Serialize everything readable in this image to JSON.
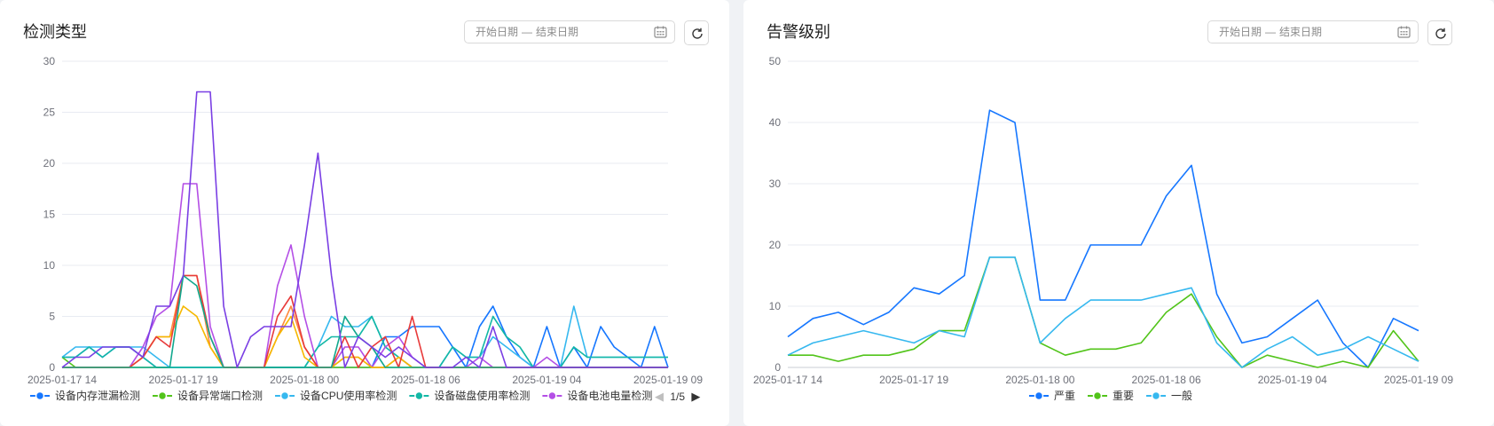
{
  "panels": {
    "left": {
      "title": "检测类型",
      "date_start_placeholder": "开始日期",
      "date_separator": "—",
      "date_end_placeholder": "结束日期",
      "legend_page": "1/5"
    },
    "right": {
      "title": "告警级别",
      "date_start_placeholder": "开始日期",
      "date_separator": "—",
      "date_end_placeholder": "结束日期"
    }
  },
  "icons": {
    "calendar": "calendar-icon",
    "refresh": "refresh-icon",
    "prev": "triangle-left-icon",
    "next": "triangle-right-icon"
  },
  "chart_data": [
    {
      "type": "line",
      "x_tick_labels": [
        "2025-01-17 14",
        "2025-01-17 19",
        "2025-01-18 00",
        "2025-01-18 06",
        "2025-01-19 04",
        "2025-01-19 09"
      ],
      "ylim": [
        0,
        30
      ],
      "yticks": [
        0,
        5,
        10,
        15,
        20,
        25,
        30
      ],
      "grid": true,
      "legend_position": "bottom",
      "series": [
        {
          "name": "设备内存泄漏检测",
          "color": "#1677ff",
          "values": [
            1,
            1,
            2,
            1,
            2,
            2,
            1,
            0,
            0,
            0,
            0,
            0,
            0,
            0,
            0,
            0,
            0,
            0,
            0,
            0,
            0,
            0,
            0,
            0,
            3,
            3,
            4,
            4,
            4,
            2,
            0,
            4,
            6,
            3,
            1,
            0,
            4,
            0,
            2,
            0,
            4,
            2,
            1,
            0,
            4,
            0
          ]
        },
        {
          "name": "设备异常端口检测",
          "color": "#52c41a",
          "values": [
            1,
            0,
            0,
            0,
            0,
            0,
            0,
            0,
            0,
            0,
            0,
            0,
            0,
            0,
            0,
            0,
            0,
            0,
            0,
            0,
            0,
            0,
            0,
            0,
            0,
            0,
            0,
            0,
            0,
            0,
            0,
            0,
            0,
            0,
            0,
            0,
            0,
            0,
            0,
            0,
            0,
            0,
            0,
            0,
            0,
            0
          ]
        },
        {
          "name": "设备CPU使用率检测",
          "color": "#36b8ef",
          "values": [
            1,
            2,
            2,
            2,
            2,
            2,
            2,
            1,
            0,
            0,
            0,
            0,
            0,
            0,
            0,
            0,
            0,
            0,
            0,
            2,
            5,
            4,
            4,
            5,
            2,
            1,
            0,
            0,
            0,
            2,
            1,
            1,
            3,
            2,
            1,
            0,
            0,
            0,
            6,
            1,
            1,
            1,
            1,
            1,
            1,
            1
          ]
        },
        {
          "name": "设备磁盘使用率检测",
          "color": "#13b8a6",
          "values": [
            1,
            1,
            2,
            1,
            2,
            2,
            1,
            0,
            0,
            0,
            0,
            0,
            0,
            0,
            0,
            0,
            0,
            0,
            0,
            2,
            3,
            3,
            3,
            5,
            2,
            1,
            0,
            0,
            0,
            2,
            1,
            1,
            5,
            3,
            2,
            0,
            0,
            0,
            2,
            1,
            1,
            1,
            1,
            1,
            1,
            1
          ]
        },
        {
          "name": "设备电池电量检测",
          "color": "#b44fe6",
          "values": [
            0,
            0,
            0,
            0,
            0,
            0,
            2,
            5,
            6,
            18,
            18,
            4,
            0,
            0,
            0,
            0,
            8,
            12,
            5,
            0,
            0,
            2,
            2,
            0,
            2,
            3,
            1,
            0,
            0,
            0,
            0,
            1,
            0,
            0,
            0,
            0,
            1,
            0,
            0,
            0,
            0,
            0,
            0,
            0,
            0,
            0
          ]
        },
        {
          "name": "",
          "color": "#ff8a3d",
          "values": [
            0,
            0,
            0,
            0,
            0,
            0,
            1,
            3,
            3,
            9,
            9,
            2,
            0,
            0,
            0,
            0,
            3,
            6,
            2,
            0,
            0,
            1,
            1,
            0,
            0,
            1,
            0,
            0,
            0,
            0,
            0,
            0,
            0,
            0,
            0,
            0,
            0,
            0,
            0,
            0,
            0,
            0,
            0,
            0,
            0,
            0
          ]
        },
        {
          "name": "",
          "color": "#f5b800",
          "values": [
            0,
            0,
            0,
            0,
            0,
            0,
            1,
            3,
            3,
            6,
            5,
            2,
            0,
            0,
            0,
            0,
            3,
            5,
            1,
            0,
            0,
            1,
            1,
            0,
            0,
            1,
            0,
            0,
            0,
            0,
            0,
            0,
            0,
            0,
            0,
            0,
            0,
            0,
            0,
            0,
            0,
            0,
            0,
            0,
            0,
            0
          ]
        },
        {
          "name": "",
          "color": "#e83b3b",
          "values": [
            0,
            0,
            0,
            0,
            0,
            0,
            1,
            3,
            2,
            9,
            9,
            3,
            0,
            0,
            0,
            0,
            5,
            7,
            2,
            0,
            0,
            3,
            0,
            2,
            3,
            0,
            5,
            0,
            0,
            0,
            0,
            0,
            0,
            0,
            0,
            0,
            0,
            0,
            0,
            0,
            0,
            0,
            0,
            0,
            0,
            0
          ]
        },
        {
          "name": "",
          "color": "#12a88e",
          "values": [
            0,
            0,
            0,
            0,
            0,
            0,
            0,
            0,
            0,
            9,
            8,
            3,
            0,
            0,
            0,
            0,
            0,
            0,
            0,
            0,
            0,
            5,
            3,
            2,
            0,
            0,
            0,
            0,
            0,
            0,
            0,
            0,
            0,
            0,
            0,
            0,
            0,
            0,
            0,
            0,
            0,
            0,
            0,
            0,
            0,
            0
          ]
        },
        {
          "name": "",
          "color": "#7a3fe4",
          "values": [
            0,
            1,
            1,
            2,
            2,
            2,
            1,
            6,
            6,
            9,
            27,
            27,
            6,
            0,
            3,
            4,
            4,
            4,
            12,
            21,
            9,
            0,
            3,
            2,
            1,
            2,
            1,
            0,
            0,
            0,
            1,
            0,
            4,
            0,
            0,
            0,
            0,
            0,
            0,
            0,
            0,
            0,
            0,
            0,
            0,
            0
          ]
        }
      ]
    },
    {
      "type": "line",
      "x_tick_labels": [
        "2025-01-17 14",
        "2025-01-17 19",
        "2025-01-18 00",
        "2025-01-18 06",
        "2025-01-19 04",
        "2025-01-19 09"
      ],
      "ylim": [
        0,
        50
      ],
      "yticks": [
        0,
        10,
        20,
        30,
        40,
        50
      ],
      "grid": true,
      "legend_position": "bottom",
      "series": [
        {
          "name": "严重",
          "color": "#1677ff",
          "values": [
            5,
            8,
            9,
            7,
            9,
            13,
            12,
            15,
            42,
            40,
            11,
            11,
            20,
            20,
            20,
            28,
            33,
            12,
            4,
            5,
            8,
            11,
            4,
            0,
            8,
            6
          ]
        },
        {
          "name": "重要",
          "color": "#52c41a",
          "values": [
            2,
            2,
            1,
            2,
            2,
            3,
            6,
            6,
            18,
            18,
            4,
            2,
            3,
            3,
            4,
            9,
            12,
            5,
            0,
            2,
            1,
            0,
            1,
            0,
            6,
            1
          ]
        },
        {
          "name": "一般",
          "color": "#36b8ef",
          "values": [
            2,
            4,
            5,
            6,
            5,
            4,
            6,
            5,
            18,
            18,
            4,
            8,
            11,
            11,
            11,
            12,
            13,
            4,
            0,
            3,
            5,
            2,
            3,
            5,
            3,
            1
          ]
        }
      ]
    }
  ]
}
